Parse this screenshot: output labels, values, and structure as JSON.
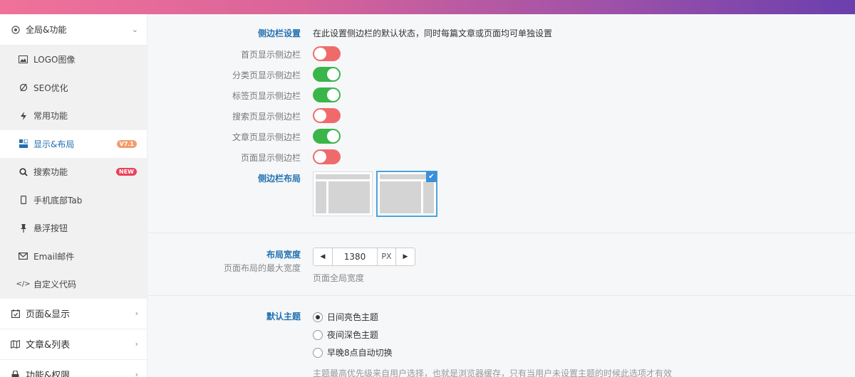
{
  "sidebar": {
    "top": {
      "label": "全局&功能",
      "icon": "gear-icon"
    },
    "sub_items": [
      {
        "label": "LOGO图像",
        "icon": "image-icon"
      },
      {
        "label": "SEO优化",
        "icon": "seo-icon"
      },
      {
        "label": "常用功能",
        "icon": "lightning-icon"
      },
      {
        "label": "显示&布局",
        "icon": "layout-icon",
        "badge": "V7.1",
        "active": true
      },
      {
        "label": "搜索功能",
        "icon": "search-icon",
        "badge": "NEW"
      },
      {
        "label": "手机底部Tab",
        "icon": "mobile-icon"
      },
      {
        "label": "悬浮按钮",
        "icon": "pin-icon"
      },
      {
        "label": "Email邮件",
        "icon": "mail-icon"
      },
      {
        "label": "自定义代码",
        "icon": "code-icon"
      }
    ],
    "main_items": [
      {
        "label": "页面&显示",
        "icon": "calendar-check-icon"
      },
      {
        "label": "文章&列表",
        "icon": "map-icon"
      },
      {
        "label": "功能&权限",
        "icon": "lock-icon"
      }
    ]
  },
  "settings": {
    "sidebar_heading": "侧边栏设置",
    "sidebar_desc": "在此设置侧边栏的默认状态，同时每篇文章或页面均可单独设置",
    "toggles": [
      {
        "label": "首页显示侧边栏",
        "on": false
      },
      {
        "label": "分类页显示侧边栏",
        "on": true
      },
      {
        "label": "标签页显示侧边栏",
        "on": true
      },
      {
        "label": "搜索页显示侧边栏",
        "on": false
      },
      {
        "label": "文章页显示侧边栏",
        "on": true
      },
      {
        "label": "页面显示侧边栏",
        "on": false
      }
    ],
    "layout_heading": "侧边栏布局",
    "layout_selected": "right-sidebar",
    "width": {
      "heading": "布局宽度",
      "subtitle": "页面布局的最大宽度",
      "value": "1380",
      "unit": "PX",
      "hint": "页面全局宽度"
    },
    "theme": {
      "heading": "默认主题",
      "options": [
        {
          "label": "日间亮色主题",
          "checked": true
        },
        {
          "label": "夜间深色主题",
          "checked": false
        },
        {
          "label": "早晚8点自动切换",
          "checked": false
        }
      ],
      "note": "主题最高优先级来自用户选择，也就是浏览器缓存，只有当用户未设置主题的时候此选项才有效"
    }
  },
  "colors": {
    "accent": "#2271b1",
    "toggle_on": "#3ab54a",
    "toggle_off": "#ef6b6b"
  }
}
